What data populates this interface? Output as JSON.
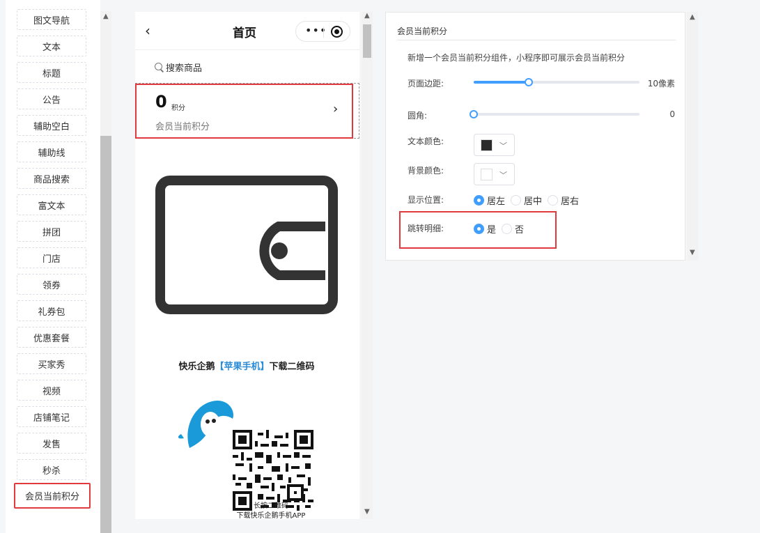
{
  "components": [
    {
      "label": "图文导航"
    },
    {
      "label": "文本"
    },
    {
      "label": "标题"
    },
    {
      "label": "公告"
    },
    {
      "label": "辅助空白"
    },
    {
      "label": "辅助线"
    },
    {
      "label": "商品搜索"
    },
    {
      "label": "富文本"
    },
    {
      "label": "拼团"
    },
    {
      "label": "门店"
    },
    {
      "label": "领券"
    },
    {
      "label": "礼券包"
    },
    {
      "label": "优惠套餐"
    },
    {
      "label": "买家秀"
    },
    {
      "label": "视频"
    },
    {
      "label": "店铺笔记"
    },
    {
      "label": "发售"
    },
    {
      "label": "秒杀"
    },
    {
      "label": "会员当前积分",
      "active": true
    }
  ],
  "phone": {
    "title": "首页",
    "more_icon": "more-dots-icon",
    "search_placeholder": "搜索商品",
    "points_value": "0",
    "points_unit": "积分",
    "points_desc": "会员当前积分",
    "promo_prefix": "快乐企鹅",
    "promo_highlight": "【苹果手机】",
    "promo_suffix": "下载二维码",
    "promo_caption_line1": "长按二维码",
    "promo_caption_line2": "下载快乐企鹅手机APP"
  },
  "settings": {
    "title": "会员当前积分",
    "description": "新增一个会员当前积分组件，小程序即可展示会员当前积分",
    "margin_label": "页面边距:",
    "margin_value": 10,
    "margin_max": 30,
    "margin_display": "10像素",
    "radius_label": "圆角:",
    "radius_value": 0,
    "radius_display": "0",
    "text_color_label": "文本颜色:",
    "text_color": "#2b2b2b",
    "bg_color_label": "背景颜色:",
    "bg_color": "#ffffff",
    "position_label": "显示位置:",
    "position_options": [
      "居左",
      "居中",
      "居右"
    ],
    "position_selected": "居左",
    "jump_label": "跳转明细:",
    "jump_options": [
      "是",
      "否"
    ],
    "jump_selected": "是"
  },
  "colors": {
    "accent": "#409eff",
    "highlight_red": "#e0393e",
    "promo_blue": "#2a8bd6"
  }
}
